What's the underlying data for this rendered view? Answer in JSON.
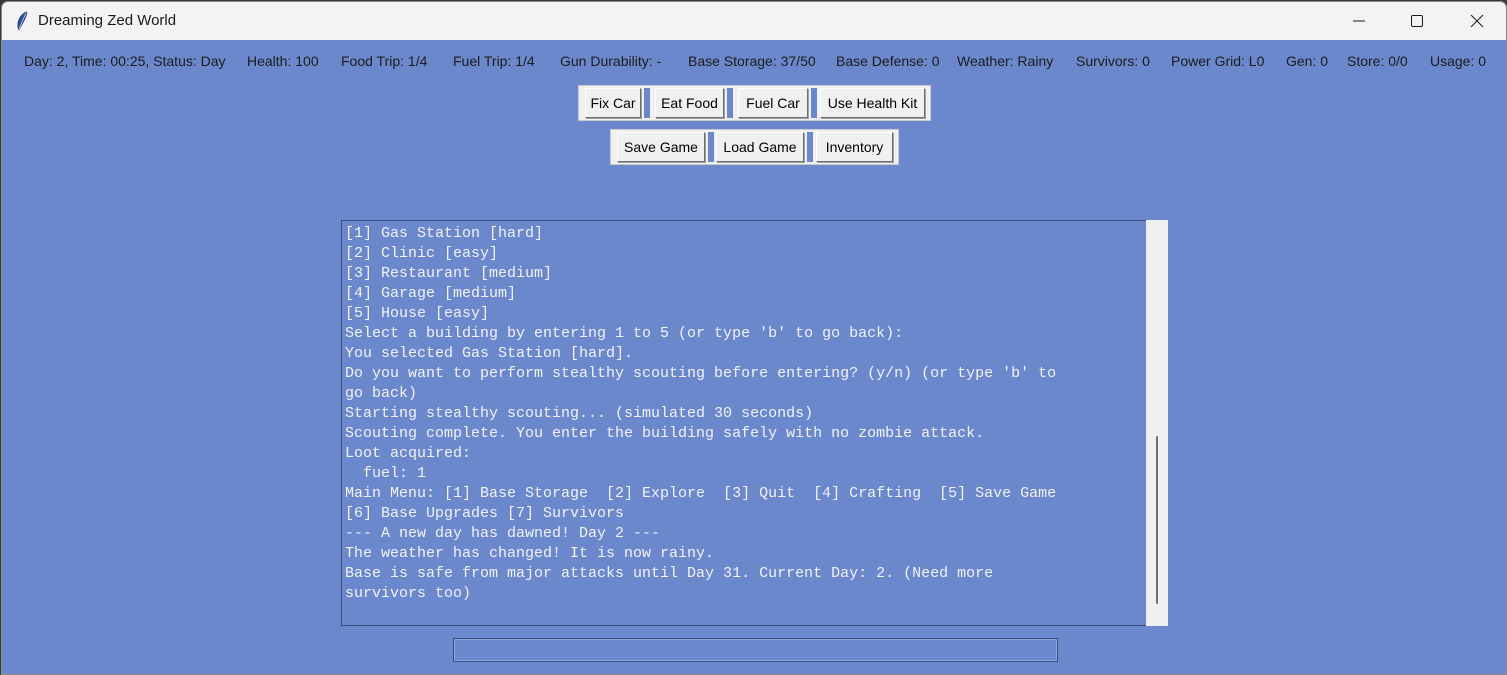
{
  "window": {
    "title": "Dreaming Zed World",
    "icon": "feather-icon"
  },
  "status": {
    "day_time": "Day: 2, Time: 00:25, Status: Day",
    "health": "Health: 100",
    "food_trip": "Food Trip: 1/4",
    "fuel_trip": "Fuel Trip: 1/4",
    "gun_durability": "Gun Durability: -",
    "base_storage": "Base Storage: 37/50",
    "base_defense": "Base Defense: 0",
    "weather": "Weather: Rainy",
    "survivors": "Survivors: 0",
    "power_grid": "Power Grid: L0",
    "gen": "Gen: 0",
    "store": "Store: 0/0",
    "usage": "Usage: 0"
  },
  "actions_row1": [
    "Fix Car",
    "Eat Food",
    "Fuel Car",
    "Use Health Kit"
  ],
  "actions_row2": [
    "Save Game",
    "Load Game",
    "Inventory"
  ],
  "log_lines": [
    "[1] Gas Station [hard]",
    "[2] Clinic [easy]",
    "[3] Restaurant [medium]",
    "[4] Garage [medium]",
    "[5] House [easy]",
    "Select a building by entering 1 to 5 (or type 'b' to go back):",
    "You selected Gas Station [hard].",
    "Do you want to perform stealthy scouting before entering? (y/n) (or type 'b' to",
    "go back)",
    "Starting stealthy scouting... (simulated 30 seconds)",
    "Scouting complete. You enter the building safely with no zombie attack.",
    "Loot acquired:",
    "  fuel: 1",
    "Main Menu: [1] Base Storage  [2] Explore  [3] Quit  [4] Crafting  [5] Save Game",
    "[6] Base Upgrades [7] Survivors",
    "--- A new day has dawned! Day 2 ---",
    "The weather has changed! It is now rainy.",
    "Base is safe from major attacks until Day 31. Current Day: 2. (Need more",
    "survivors too)"
  ],
  "command_entry": {
    "value": ""
  },
  "colors": {
    "background": "#6b88cc",
    "text": "#f2f2f2",
    "button": "#f0f0f0"
  }
}
